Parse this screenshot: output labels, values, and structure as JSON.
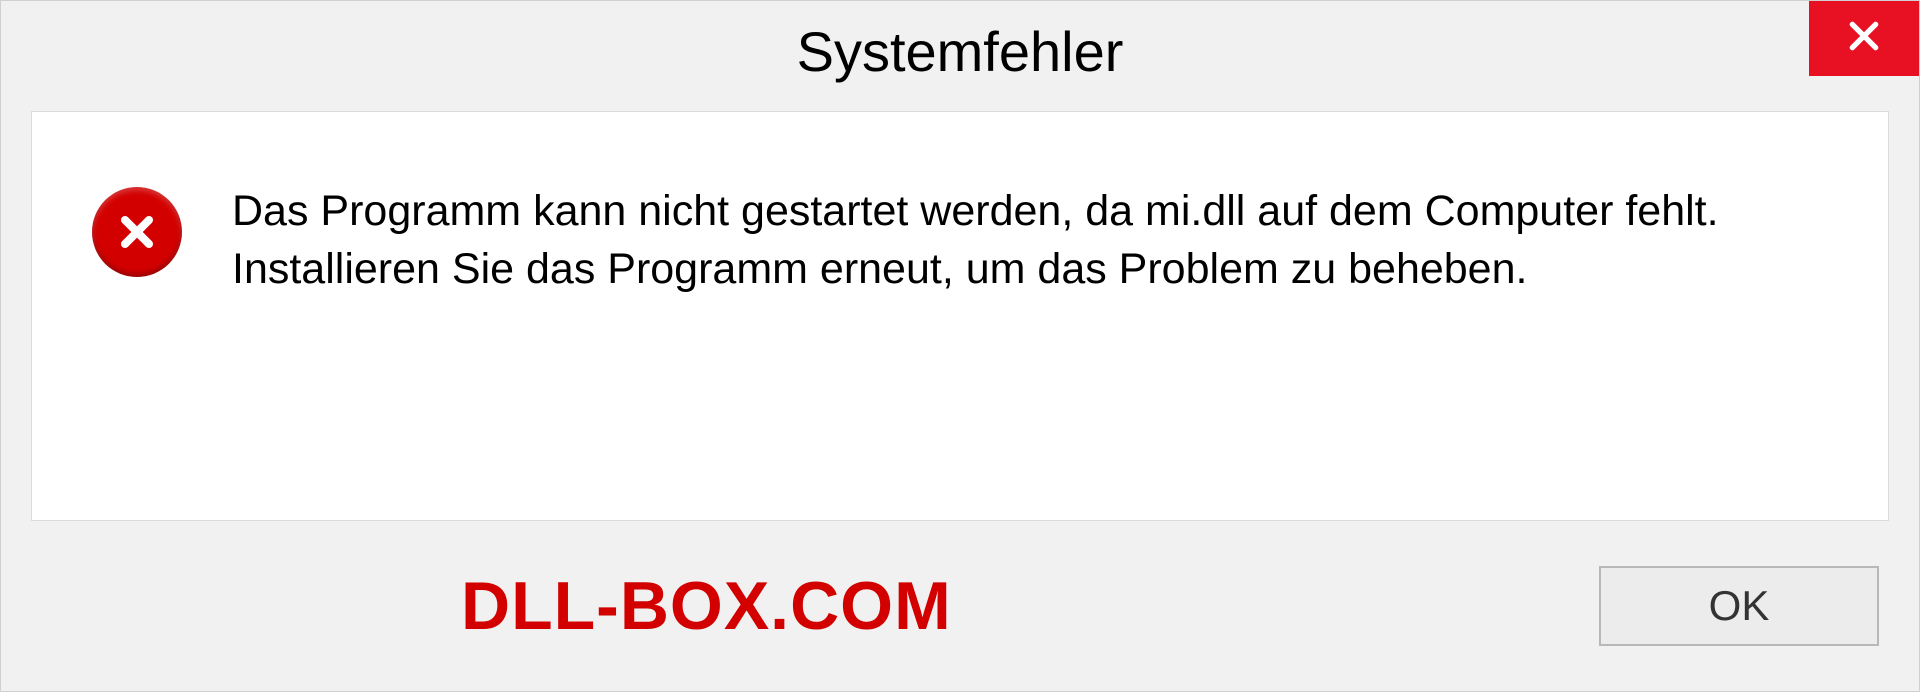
{
  "dialog": {
    "title": "Systemfehler",
    "message": "Das Programm kann nicht gestartet werden, da mi.dll auf dem Computer fehlt. Installieren Sie das Programm erneut, um das Problem zu beheben.",
    "ok_label": "OK"
  },
  "watermark": "DLL-BOX.COM",
  "colors": {
    "close_bg": "#e81123",
    "error_red": "#d30000",
    "dialog_bg": "#f1f1f1"
  }
}
